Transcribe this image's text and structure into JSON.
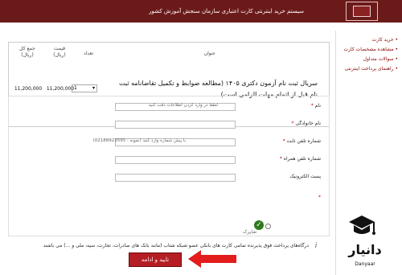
{
  "header": {
    "title": "سیستم خرید اینترنتی کارت اعتباری سازمان سنجش آموزش کشور"
  },
  "sidebar": {
    "items": [
      {
        "label": "خرید کارت"
      },
      {
        "label": "مشاهده مشخصات کارت"
      },
      {
        "label": "سوالات متداول"
      },
      {
        "label": "راهنمای پرداخت اینترنتی"
      }
    ]
  },
  "table": {
    "headers": {
      "title": "عنوان",
      "count": "تعداد",
      "price": "قیمت\n(ریال)",
      "total": "جمع کل\n(ریال)"
    },
    "row": {
      "title": "سریال ثبت نام آزمون دکتری ۱۴۰۵ (مطالعه ضوابط و تکمیل تقاضانامه ثبت نام قبل از اتمام مهلت الزامی است)",
      "count": "1",
      "price": "11,200,000",
      "total": "11,200,000"
    }
  },
  "form": {
    "fields": {
      "first_name": {
        "label": "نام",
        "hint": "لطفا در وارد کردن اطلاعات دقت کنید"
      },
      "last_name": {
        "label": "نام خانوادگی"
      },
      "landline": {
        "label": "شماره تلفن ثابت",
        "hint": "با پیش شماره وارد کنید (نمونه : 02188923595)"
      },
      "mobile": {
        "label": "شماره تلفن همراه"
      },
      "email": {
        "label": "پست الکترونیک"
      }
    },
    "gateway": {
      "label": "درگاه پرداخت",
      "option_name": "شاپرک"
    },
    "info_text": "درگاه‌های پرداخت فوق پذیرنده تمامی کارت های بانکی عضو شبکه شتاب (مانند بانک های صادرات، تجارت، سپه، ملی و ...) می باشند",
    "submit_label": "تایید و ادامه"
  },
  "branding": {
    "name": "دانیار",
    "sub": "Danyaar"
  },
  "colors": {
    "header_bg": "#6b1a1a",
    "primary": "#b51e24",
    "required": "#cc0000",
    "gateway_check": "#2f7a1d"
  }
}
